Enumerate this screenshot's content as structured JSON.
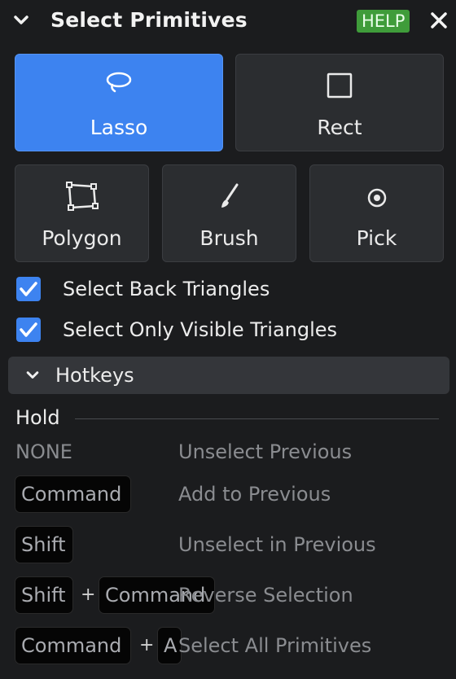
{
  "panel": {
    "title": "Select Primitives",
    "help_label": "HELP",
    "icons": {
      "collapse": "chevron-down-icon",
      "close": "close-icon"
    }
  },
  "tools": [
    {
      "label": "Lasso",
      "icon": "lasso-icon",
      "active": true
    },
    {
      "label": "Rect",
      "icon": "rect-icon",
      "active": false
    },
    {
      "label": "Polygon",
      "icon": "polygon-icon",
      "active": false
    },
    {
      "label": "Brush",
      "icon": "brush-icon",
      "active": false
    },
    {
      "label": "Pick",
      "icon": "pick-icon",
      "active": false
    }
  ],
  "options": [
    {
      "label": "Select Back Triangles",
      "checked": true
    },
    {
      "label": "Select Only Visible Triangles",
      "checked": true
    }
  ],
  "hotkeys": {
    "section_label": "Hotkeys",
    "hold_label": "Hold",
    "rows": [
      {
        "keys": [
          "NONE"
        ],
        "description": "Unselect Previous"
      },
      {
        "keys": [
          "Command"
        ],
        "description": "Add to Previous"
      },
      {
        "keys": [
          "Shift"
        ],
        "description": "Unselect in Previous"
      },
      {
        "keys": [
          "Shift",
          "Command"
        ],
        "joiner": "+",
        "description": "Reverse Selection"
      },
      {
        "keys": [
          "Command",
          "A"
        ],
        "joiner": "+",
        "description": "Select All Primitives"
      }
    ]
  },
  "colors": {
    "background": "#1b1c1e",
    "accent": "#3d83f0",
    "help_badge": "#3f9c3a",
    "button": "#2b2d30"
  }
}
